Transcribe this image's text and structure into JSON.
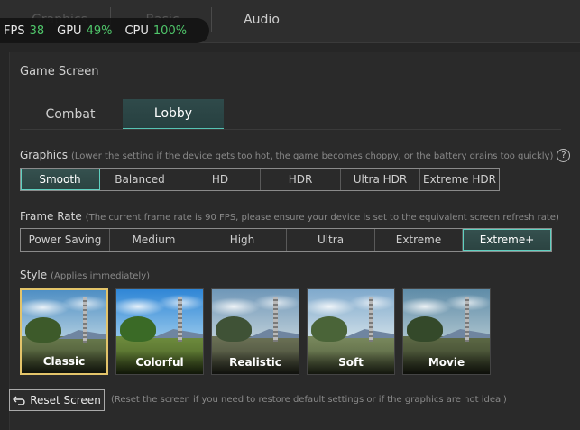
{
  "top_tabs": [
    {
      "label": "Graphics",
      "dim": true
    },
    {
      "label": "Basic",
      "dim": true
    },
    {
      "label": "Audio",
      "dim": false
    }
  ],
  "perf": {
    "fps_label": "FPS",
    "fps_value": "38",
    "gpu_label": "GPU",
    "gpu_value": "49%",
    "cpu_label": "CPU",
    "cpu_value": "100%"
  },
  "section_title": "Game Screen",
  "sub_tabs": [
    {
      "label": "Combat",
      "active": false
    },
    {
      "label": "Lobby",
      "active": true
    }
  ],
  "graphics": {
    "label": "Graphics",
    "hint": "(Lower the setting if the device gets too hot, the game becomes choppy, or the battery drains too quickly)",
    "help_icon": "?",
    "options": [
      "Smooth",
      "Balanced",
      "HD",
      "HDR",
      "Ultra HDR",
      "Extreme HDR"
    ],
    "selected": "Smooth"
  },
  "frame_rate": {
    "label": "Frame Rate",
    "hint": "(The current frame rate is 90 FPS, please ensure your device is set to the equivalent screen refresh rate)",
    "options": [
      "Power Saving",
      "Medium",
      "High",
      "Ultra",
      "Extreme",
      "Extreme+"
    ],
    "selected": "Extreme+"
  },
  "style": {
    "label": "Style",
    "hint": "(Applies immediately)",
    "options": [
      "Classic",
      "Colorful",
      "Realistic",
      "Soft",
      "Movie"
    ],
    "selected": "Classic"
  },
  "reset": {
    "label": "Reset Screen",
    "hint": "(Reset the screen if you need to restore default settings or if the graphics are not ideal)"
  },
  "colors": {
    "accent_teal": "#5fd0c0",
    "selected_gold": "#e3c46a",
    "perf_green": "#4fc56a"
  }
}
